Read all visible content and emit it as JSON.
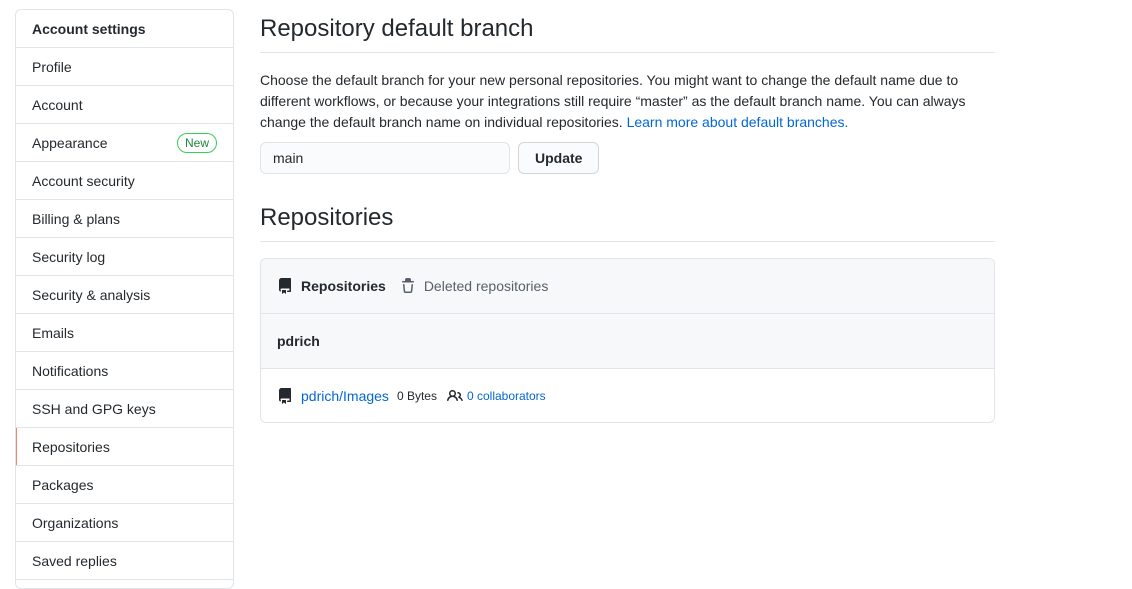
{
  "sidebar": {
    "header": "Account settings",
    "items": [
      {
        "label": "Profile"
      },
      {
        "label": "Account"
      },
      {
        "label": "Appearance",
        "badge": "New"
      },
      {
        "label": "Account security"
      },
      {
        "label": "Billing & plans"
      },
      {
        "label": "Security log"
      },
      {
        "label": "Security & analysis"
      },
      {
        "label": "Emails"
      },
      {
        "label": "Notifications"
      },
      {
        "label": "SSH and GPG keys"
      },
      {
        "label": "Repositories",
        "selected": true
      },
      {
        "label": "Packages"
      },
      {
        "label": "Organizations"
      },
      {
        "label": "Saved replies"
      }
    ]
  },
  "default_branch": {
    "title": "Repository default branch",
    "description": "Choose the default branch for your new personal repositories. You might want to change the default name due to different workflows, or because your integrations still require “master” as the default branch name. You can always change the default branch name on individual repositories.",
    "learn_more": "Learn more about default branches.",
    "input_value": "main",
    "update_label": "Update"
  },
  "repositories": {
    "title": "Repositories",
    "tabs": [
      {
        "label": "Repositories",
        "icon": "repo-icon",
        "active": true
      },
      {
        "label": "Deleted repositories",
        "icon": "trash-icon",
        "active": false
      }
    ],
    "owner": "pdrich",
    "list": [
      {
        "name": "pdrich/Images",
        "size": "0 Bytes",
        "collaborators": "0 collaborators"
      }
    ]
  },
  "colors": {
    "link": "#0366d6",
    "selected_indicator": "#f9826c",
    "badge": "#22863a"
  }
}
